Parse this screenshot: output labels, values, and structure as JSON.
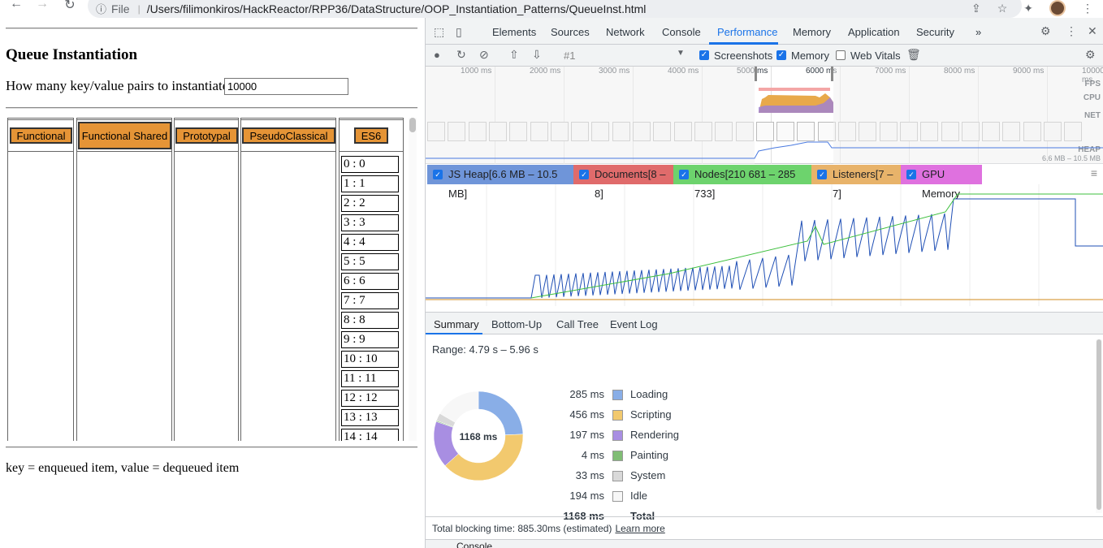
{
  "browser": {
    "info_label": "ⓘ",
    "scheme_label": "File",
    "url": "/Users/filimonkiros/HackReactor/RPP36/DataStructure/OOP_Instantiation_Patterns/QueueInst.html"
  },
  "page": {
    "title": "Queue Instantiation",
    "prompt": "How many key/value pairs to instantiate?",
    "count_value": "10000",
    "buttons": {
      "functional": "Functional",
      "functional_shared": "Functional Shared",
      "prototypal": "Prototypal",
      "pseudoclassical": "PseudoClassical",
      "es6": "ES6"
    },
    "es6_items": [
      "0 : 0",
      "1 : 1",
      "2 : 2",
      "3 : 3",
      "4 : 4",
      "5 : 5",
      "6 : 6",
      "7 : 7",
      "8 : 8",
      "9 : 9",
      "10 : 10",
      "11 : 11",
      "12 : 12",
      "13 : 13",
      "14 : 14"
    ],
    "legend": "key = enqueued item, value = dequeued item"
  },
  "devtools": {
    "tabs": [
      "Elements",
      "Sources",
      "Network",
      "Console",
      "Performance",
      "Memory",
      "Application",
      "Security"
    ],
    "active_tab": "Performance",
    "more_tabs": "»",
    "toolbar": {
      "profile_select": "#1",
      "screenshots_label": "Screenshots",
      "screenshots_checked": true,
      "memory_label": "Memory",
      "memory_checked": true,
      "webvitals_label": "Web Vitals",
      "webvitals_checked": false
    },
    "overview": {
      "ticks": [
        "1000 ms",
        "2000 ms",
        "3000 ms",
        "4000 ms",
        "5000 ms",
        "6000 ms",
        "7000 ms",
        "8000 ms",
        "9000 ms",
        "10000 ms"
      ],
      "rows": [
        "FPS",
        "CPU",
        "NET",
        "HEAP"
      ],
      "heap_range": "6.6 MB – 10.5 MB"
    },
    "counters": [
      {
        "label": "JS Heap[6.6 MB – 10.5 MB]",
        "color": "#6f95d9"
      },
      {
        "label": "Documents[8 – 8]",
        "color": "#e06b6b"
      },
      {
        "label": "Nodes[210 681 – 285 733]",
        "color": "#6dd36d"
      },
      {
        "label": "Listeners[7 – 7]",
        "color": "#e8b36a"
      },
      {
        "label": "GPU Memory",
        "color": "#df71df"
      }
    ],
    "bottom_tabs": [
      "Summary",
      "Bottom-Up",
      "Call Tree",
      "Event Log"
    ],
    "active_bottom_tab": "Summary",
    "summary": {
      "range": "Range: 4.79 s – 5.96 s",
      "total_center": "1168 ms",
      "rows": [
        {
          "value": "285 ms",
          "name": "Loading",
          "color": "#89aee7"
        },
        {
          "value": "456 ms",
          "name": "Scripting",
          "color": "#f2c96e"
        },
        {
          "value": "197 ms",
          "name": "Rendering",
          "color": "#a88ee2"
        },
        {
          "value": "4 ms",
          "name": "Painting",
          "color": "#80bd75"
        },
        {
          "value": "33 ms",
          "name": "System",
          "color": "#d9d9d9"
        },
        {
          "value": "194 ms",
          "name": "Idle",
          "color": "#f7f7f7"
        }
      ],
      "total_value": "1168 ms",
      "total_label": "Total"
    },
    "blocking": "Total blocking time: 885.30ms (estimated)",
    "learn_more": "Learn more",
    "console_label": "Console"
  }
}
